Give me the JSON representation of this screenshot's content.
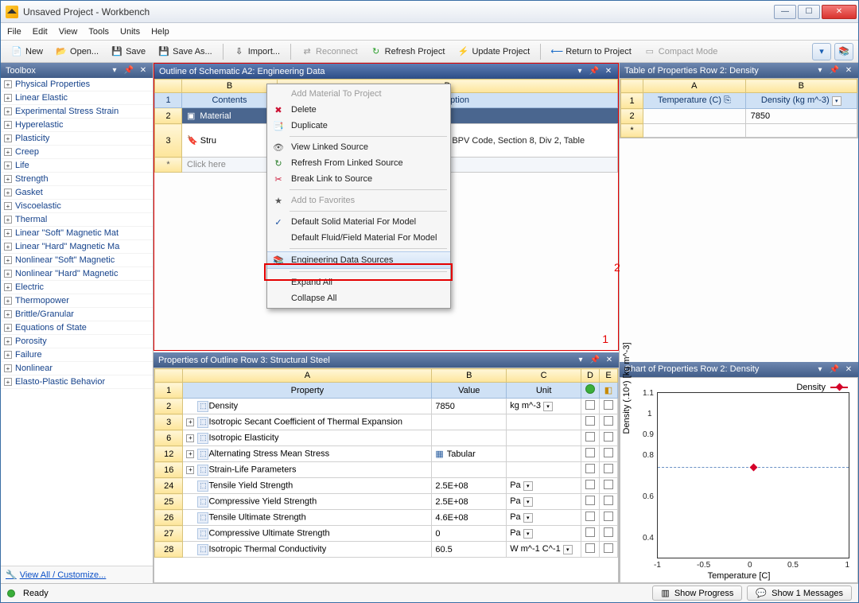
{
  "window": {
    "title": "Unsaved Project - Workbench"
  },
  "menu": [
    "File",
    "Edit",
    "View",
    "Tools",
    "Units",
    "Help"
  ],
  "toolbar": {
    "new": "New",
    "open": "Open...",
    "save": "Save",
    "saveas": "Save As...",
    "import": "Import...",
    "reconnect": "Reconnect",
    "refresh": "Refresh Project",
    "update": "Update Project",
    "return": "Return to Project",
    "compact": "Compact Mode"
  },
  "toolbox": {
    "title": "Toolbox",
    "categories": [
      "Physical Properties",
      "Linear Elastic",
      "Experimental Stress Strain",
      "Hyperelastic",
      "Plasticity",
      "Creep",
      "Life",
      "Strength",
      "Gasket",
      "Viscoelastic",
      "Thermal",
      "Linear \"Soft\" Magnetic Mat",
      "Linear \"Hard\" Magnetic Ma",
      "Nonlinear \"Soft\" Magnetic",
      "Nonlinear \"Hard\" Magnetic",
      "Electric",
      "Thermopower",
      "Brittle/Granular",
      "Equations of State",
      "Porosity",
      "Failure",
      "Nonlinear",
      "Elasto-Plastic Behavior"
    ],
    "footer": "View All / Customize..."
  },
  "outline": {
    "title": "Outline of Schematic A2: Engineering Data",
    "col_B": "B",
    "col_D": "D",
    "contents_label": "Contents",
    "desc_label": "Description",
    "material_row_label": "Material",
    "row3_label": "Stru",
    "desc_text": "Data at zero mean stress comes from SME BPV Code, Section 8, Div 2, Table",
    "click_here": "Click here",
    "annotation1": "1",
    "annotation2": "2"
  },
  "context_menu": {
    "items": [
      {
        "label": "Add Material To Project",
        "disabled": true,
        "icon": ""
      },
      {
        "label": "Delete",
        "icon": "✖",
        "color": "#c13"
      },
      {
        "label": "Duplicate",
        "icon": "📑"
      },
      {
        "sep": true
      },
      {
        "label": "View Linked Source",
        "icon": "👁"
      },
      {
        "label": "Refresh From Linked Source",
        "icon": "↻",
        "color": "#2a7e2a"
      },
      {
        "label": "Break Link to Source",
        "icon": "✂",
        "color": "#c13"
      },
      {
        "sep": true
      },
      {
        "label": "Add to Favorites",
        "disabled": true,
        "icon": "★"
      },
      {
        "sep": true
      },
      {
        "label": "Default Solid Material For Model",
        "icon": "✓",
        "color": "#184fa0"
      },
      {
        "label": "Default Fluid/Field Material For Model"
      },
      {
        "sep": true
      },
      {
        "label": "Engineering Data Sources",
        "highlight": true,
        "icon": "📚"
      },
      {
        "sep": true
      },
      {
        "label": "Expand All"
      },
      {
        "label": "Collapse All"
      }
    ]
  },
  "properties": {
    "title": "Properties of Outline Row 3: Structural Steel",
    "col_A": "A",
    "col_B": "B",
    "col_C": "C",
    "col_D": "D",
    "col_E": "E",
    "head_prop": "Property",
    "head_val": "Value",
    "head_unit": "Unit",
    "rows": [
      {
        "n": "2",
        "name": "Density",
        "value": "7850",
        "unit": "kg m^-3",
        "dd": true,
        "exp": false
      },
      {
        "n": "3",
        "name": "Isotropic Secant Coefficient of Thermal Expansion",
        "value": "",
        "unit": "",
        "exp": true
      },
      {
        "n": "6",
        "name": "Isotropic Elasticity",
        "value": "",
        "unit": "",
        "exp": true
      },
      {
        "n": "12",
        "name": "Alternating Stress Mean Stress",
        "value": "Tabular",
        "unit": "",
        "exp": true,
        "tabular": true
      },
      {
        "n": "16",
        "name": "Strain-Life Parameters",
        "value": "",
        "unit": "",
        "exp": true
      },
      {
        "n": "24",
        "name": "Tensile Yield Strength",
        "value": "2.5E+08",
        "unit": "Pa",
        "dd": true
      },
      {
        "n": "25",
        "name": "Compressive Yield Strength",
        "value": "2.5E+08",
        "unit": "Pa",
        "dd": true
      },
      {
        "n": "26",
        "name": "Tensile Ultimate Strength",
        "value": "4.6E+08",
        "unit": "Pa",
        "dd": true
      },
      {
        "n": "27",
        "name": "Compressive Ultimate Strength",
        "value": "0",
        "unit": "Pa",
        "dd": true
      },
      {
        "n": "28",
        "name": "Isotropic Thermal Conductivity",
        "value": "60.5",
        "unit": "W m^-1 C^-1",
        "dd": true
      }
    ]
  },
  "density_table": {
    "title": "Table of Properties Row 2: Density",
    "col_A": "A",
    "col_B": "B",
    "temp_label": "Temperature (C)",
    "dens_label": "Density (kg m^-3)",
    "value": "7850"
  },
  "chart": {
    "title": "Chart of Properties Row 2: Density",
    "legend": "Density",
    "ylabel": "Density  (.10⁴)  [kg m^-3]",
    "xlabel": "Temperature  [C]"
  },
  "chart_data": {
    "type": "scatter",
    "series": [
      {
        "name": "Density",
        "x": [
          0
        ],
        "y": [
          0.785
        ]
      }
    ],
    "xlim": [
      -1,
      1
    ],
    "ylim": [
      0.4,
      1.1
    ],
    "xticks": [
      -1,
      -0.5,
      0,
      0.5,
      1
    ],
    "yticks": [
      0.4,
      0.6,
      0.8,
      0.9,
      1,
      1.1
    ],
    "xlabel": "Temperature  [C]",
    "ylabel": "Density (.10^4) [kg m^-3]",
    "ref_line_y": 0.785
  },
  "status": {
    "ready": "Ready",
    "show_progress": "Show Progress",
    "show_msgs": "Show 1 Messages"
  }
}
